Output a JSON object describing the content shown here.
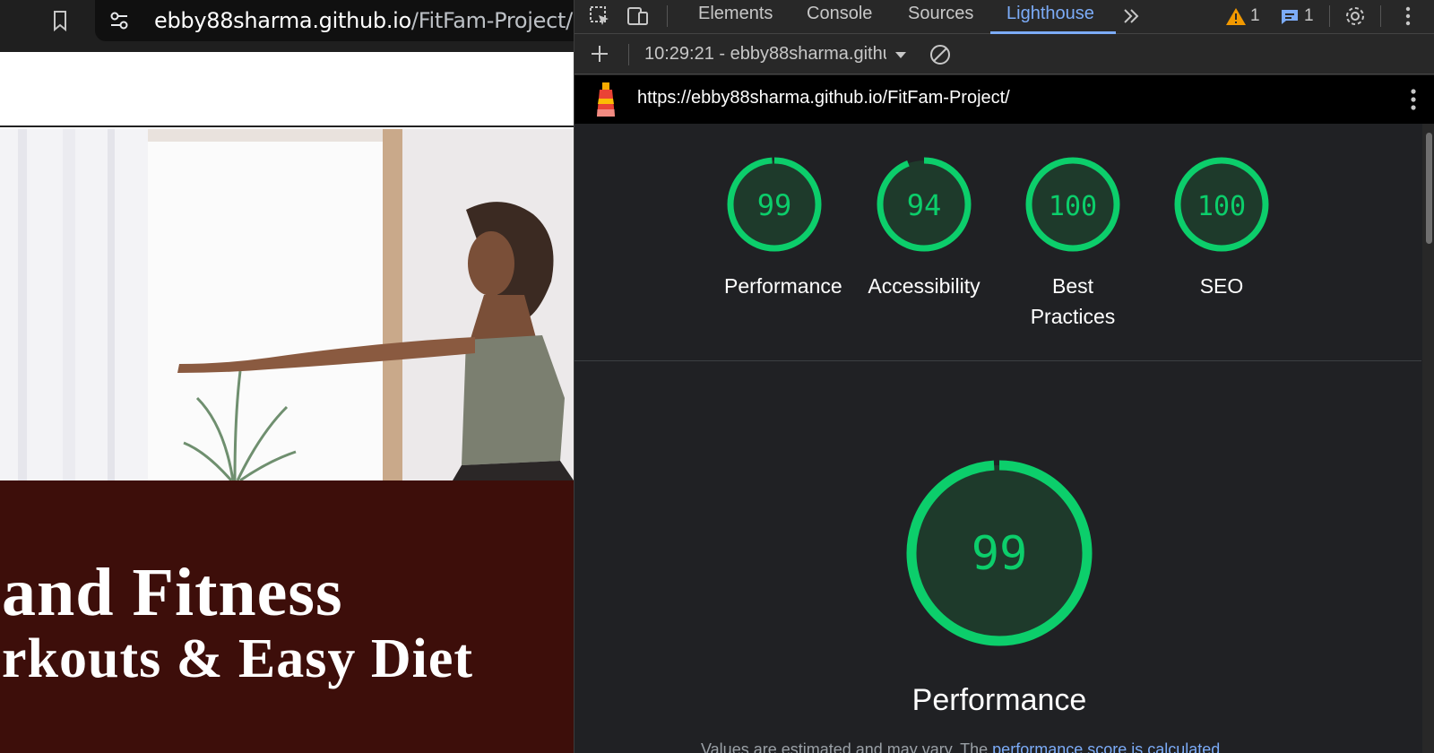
{
  "browser": {
    "url_host": "ebby88sharma.github.io",
    "url_path": "/FitFam-Project/"
  },
  "site": {
    "banner_line1": "and Fitness",
    "banner_line2": "rkouts & Easy Diet"
  },
  "devtools": {
    "tabs": [
      {
        "label": "Elements",
        "active": false
      },
      {
        "label": "Console",
        "active": false
      },
      {
        "label": "Sources",
        "active": false
      },
      {
        "label": "Lighthouse",
        "active": true
      }
    ],
    "warning_count": "1",
    "message_count": "1",
    "report_select": "10:29:21 - ebby88sharma.githu",
    "lighthouse_url": "https://ebby88sharma.github.io/FitFam-Project/"
  },
  "lighthouse": {
    "color_pass": "#0cce6b",
    "color_pass_bg": "#1e3a2b",
    "categories": [
      {
        "score": 99,
        "label": "Performance"
      },
      {
        "score": 94,
        "label": "Accessibility"
      },
      {
        "score": 100,
        "label": "Best Practices"
      },
      {
        "score": 100,
        "label": "SEO"
      }
    ],
    "main": {
      "score": 99,
      "label": "Performance"
    },
    "note_prefix": "Values are estimated and may vary. The ",
    "note_link": "performance score is calculated"
  }
}
